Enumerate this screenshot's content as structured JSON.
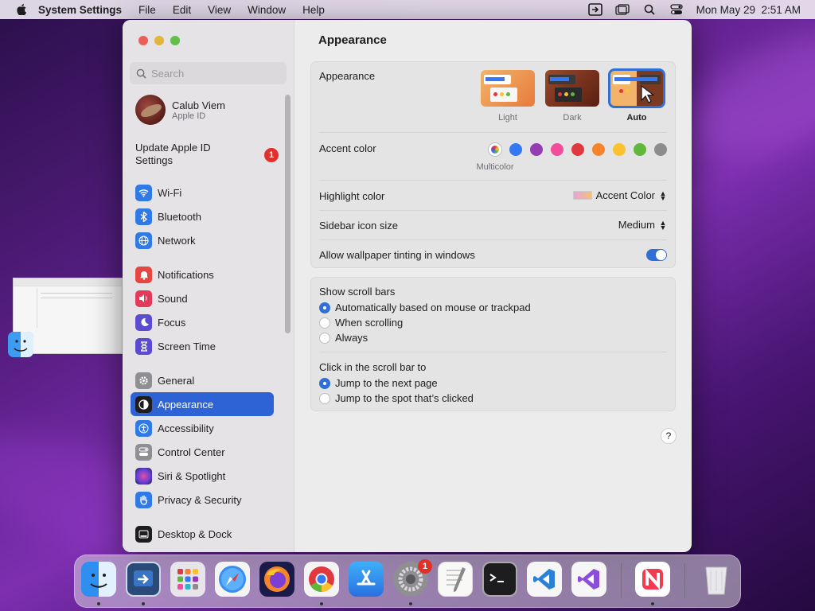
{
  "menubar": {
    "app_name": "System Settings",
    "menus": [
      "File",
      "Edit",
      "View",
      "Window",
      "Help"
    ],
    "datetime": "Mon May 29  2:51 AM"
  },
  "sidebar": {
    "search_placeholder": "Search",
    "account": {
      "name": "Calub Viem",
      "subtitle": "Apple ID"
    },
    "update_label": "Update Apple ID Settings",
    "update_badge": "1",
    "items": [
      {
        "label": "Wi-Fi",
        "icon": "wifi-icon",
        "color": "#2f7ae5"
      },
      {
        "label": "Bluetooth",
        "icon": "bluetooth-icon",
        "color": "#2f7ae5"
      },
      {
        "label": "Network",
        "icon": "globe-icon",
        "color": "#2f7ae5"
      },
      {
        "label": "Notifications",
        "icon": "bell-icon",
        "color": "#e5463f"
      },
      {
        "label": "Sound",
        "icon": "speaker-icon",
        "color": "#e23a5c"
      },
      {
        "label": "Focus",
        "icon": "moon-icon",
        "color": "#5a4bd1"
      },
      {
        "label": "Screen Time",
        "icon": "hourglass-icon",
        "color": "#5a4bd1"
      },
      {
        "label": "General",
        "icon": "gear-icon",
        "color": "#8e8e93"
      },
      {
        "label": "Appearance",
        "icon": "appearance-icon",
        "color": "#1d1d1f"
      },
      {
        "label": "Accessibility",
        "icon": "accessibility-icon",
        "color": "#2f7ae5"
      },
      {
        "label": "Control Center",
        "icon": "control-center-icon",
        "color": "#8e8e93"
      },
      {
        "label": "Siri & Spotlight",
        "icon": "siri-icon",
        "color": "#9b3fc9"
      },
      {
        "label": "Privacy & Security",
        "icon": "hand-icon",
        "color": "#2f7ae5"
      },
      {
        "label": "Desktop & Dock",
        "icon": "dock-icon",
        "color": "#1d1d1f"
      }
    ]
  },
  "content": {
    "title": "Appearance",
    "appearance": {
      "label": "Appearance",
      "options": [
        "Light",
        "Dark",
        "Auto"
      ],
      "selected": "Auto"
    },
    "accent": {
      "label": "Accent color",
      "selected_name": "Multicolor",
      "colors": [
        "#3478f6",
        "#953cb5",
        "#f24c9d",
        "#e0383e",
        "#f5842c",
        "#fbc12f",
        "#5fb83a",
        "#8c8c8c"
      ]
    },
    "highlight": {
      "label": "Highlight color",
      "value": "Accent Color"
    },
    "sidebar_icon": {
      "label": "Sidebar icon size",
      "value": "Medium"
    },
    "tinting": {
      "label": "Allow wallpaper tinting in windows",
      "enabled": true
    },
    "scroll_bars": {
      "label": "Show scroll bars",
      "options": [
        "Automatically based on mouse or trackpad",
        "When scrolling",
        "Always"
      ],
      "selected": 0
    },
    "click_scroll": {
      "label": "Click in the scroll bar to",
      "options": [
        "Jump to the next page",
        "Jump to the spot that’s clicked"
      ],
      "selected": 0
    },
    "help": "?"
  },
  "dock": {
    "apps": [
      "finder-icon",
      "remote-desktop-icon",
      "launchpad-icon",
      "safari-icon",
      "firefox-icon",
      "chrome-icon",
      "app-store-icon",
      "system-settings-icon",
      "textedit-icon",
      "terminal-icon",
      "vscode-icon",
      "visual-studio-icon",
      "news-icon",
      "trash-icon"
    ],
    "settings_badge": "1"
  }
}
